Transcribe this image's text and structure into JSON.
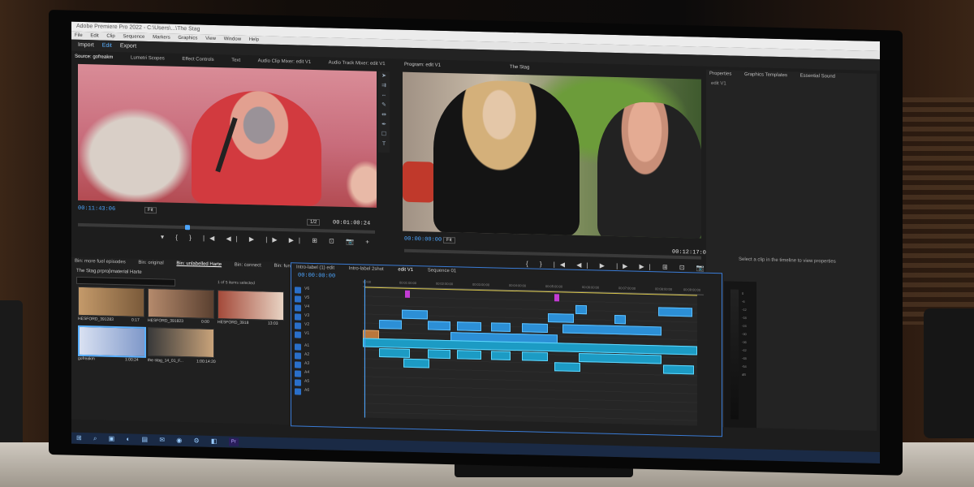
{
  "app": {
    "title": "Adobe Premiere Pro 2022 - C:\\Users\\...\\The Stag",
    "menu": [
      "File",
      "Edit",
      "Clip",
      "Sequence",
      "Markers",
      "Graphics",
      "View",
      "Window",
      "Help"
    ],
    "workspaces": [
      {
        "label": "Import",
        "active": false
      },
      {
        "label": "Edit",
        "active": true
      },
      {
        "label": "Export",
        "active": false
      }
    ]
  },
  "source_monitor": {
    "tabs": [
      "Source: gofreakm",
      "Lumetri Scopes",
      "Effect Controls",
      "Text",
      "Audio Clip Mixer: edit V1",
      "Audio Track Mixer: edit V1"
    ],
    "timecode_in": "00:11:43:06",
    "fit": "Fit",
    "zoom": "1/2",
    "timecode_out": "00:01:00:24"
  },
  "program_monitor": {
    "title": "Program: edit V1",
    "sequence_name": "The Stag",
    "timecode_in": "00:00:00:00",
    "fit": "Fit",
    "timecode_out": "00:12:17:06"
  },
  "properties": {
    "tabs": [
      "Properties",
      "Graphics Templates",
      "Essential Sound"
    ],
    "subtitle": "edit V1",
    "hint": "Select a clip in the timeline to view properties"
  },
  "project": {
    "tabs": [
      "Bin: more fuel episodes",
      "Bin: original",
      "Bin: unlabelled Harte",
      "Bin: connect",
      "Bin: fun"
    ],
    "bin_path": "The Stag.prproj\\material Harte",
    "item_count": "1 of 5 items selected",
    "items": [
      {
        "name": "HESFORD_391283",
        "duration": "0:17"
      },
      {
        "name": "HESFORD_391823",
        "duration": "0:00"
      },
      {
        "name": "HESFORD_3918",
        "duration": "13:03"
      },
      {
        "name": "gofreakm",
        "duration": "1:00:24"
      },
      {
        "name": "the stag_14_01_F...",
        "duration": "1:00:14:20"
      }
    ]
  },
  "timeline": {
    "tabs": [
      "Intro-label (1) edit",
      "Intro-label 2shot",
      "edit V1",
      "Sequence 01"
    ],
    "timecode": "00:00:00:00",
    "ruler": [
      "00:00",
      "00:01:00:00",
      "00:02:00:00",
      "00:03:00:00",
      "00:04:00:00",
      "00:05:00:00",
      "00:06:00:00",
      "00:07:00:00",
      "00:08:00:00",
      "00:09:00:00"
    ],
    "tracks": [
      "V6",
      "V5",
      "V4",
      "V3",
      "V2",
      "V1",
      "A1",
      "A2",
      "A3",
      "A4",
      "A5",
      "A6"
    ]
  },
  "meters": {
    "scale": [
      "0",
      "-6",
      "-12",
      "-18",
      "-24",
      "-30",
      "-36",
      "-42",
      "-48",
      "-54",
      "dB"
    ]
  },
  "taskbar": {
    "icons": [
      "start-icon",
      "search-icon",
      "task-view-icon",
      "edge-icon",
      "folder-icon",
      "mail-icon",
      "chrome-icon",
      "settings-icon",
      "outlook-icon",
      "premiere-icon"
    ],
    "premiere_label": "Pr"
  }
}
